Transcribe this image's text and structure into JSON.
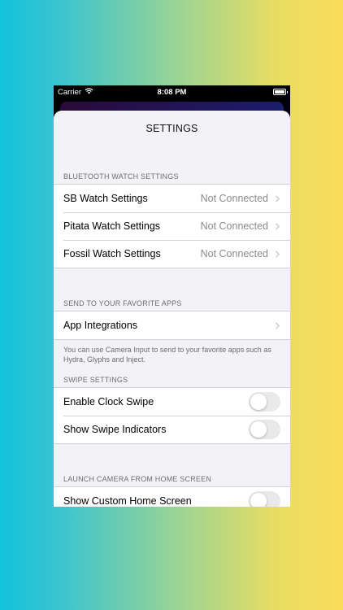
{
  "status_bar": {
    "carrier": "Carrier",
    "time": "8:08 PM"
  },
  "sheet": {
    "title": "SETTINGS"
  },
  "sections": {
    "bluetooth": {
      "header": "BLUETOOTH WATCH SETTINGS",
      "rows": [
        {
          "label": "SB Watch Settings",
          "value": "Not Connected"
        },
        {
          "label": "Pitata Watch Settings",
          "value": "Not Connected"
        },
        {
          "label": "Fossil Watch Settings",
          "value": "Not Connected"
        }
      ]
    },
    "apps": {
      "header": "SEND TO YOUR FAVORITE APPS",
      "rows": [
        {
          "label": "App Integrations"
        }
      ],
      "footer": "You can use Camera Input to send to your favorite apps such as Hydra, Glyphs and Inject."
    },
    "swipe": {
      "header": "SWIPE SETTINGS",
      "rows": [
        {
          "label": "Enable Clock Swipe",
          "on": false
        },
        {
          "label": "Show Swipe Indicators",
          "on": false
        }
      ]
    },
    "launch": {
      "header": "LAUNCH CAMERA FROM HOME SCREEN",
      "rows": [
        {
          "label": "Show Custom Home Screen",
          "on": false
        }
      ]
    }
  },
  "colors": {
    "background_left": "#12c3dc",
    "background_right": "#fbdc5a",
    "sheet_bg": "#f2f2f7",
    "secondary_text": "#8a8a8e",
    "toggle_off": "#e9e9ea"
  },
  "icons": [
    "wifi-icon",
    "battery-icon",
    "chevron-right-icon"
  ]
}
